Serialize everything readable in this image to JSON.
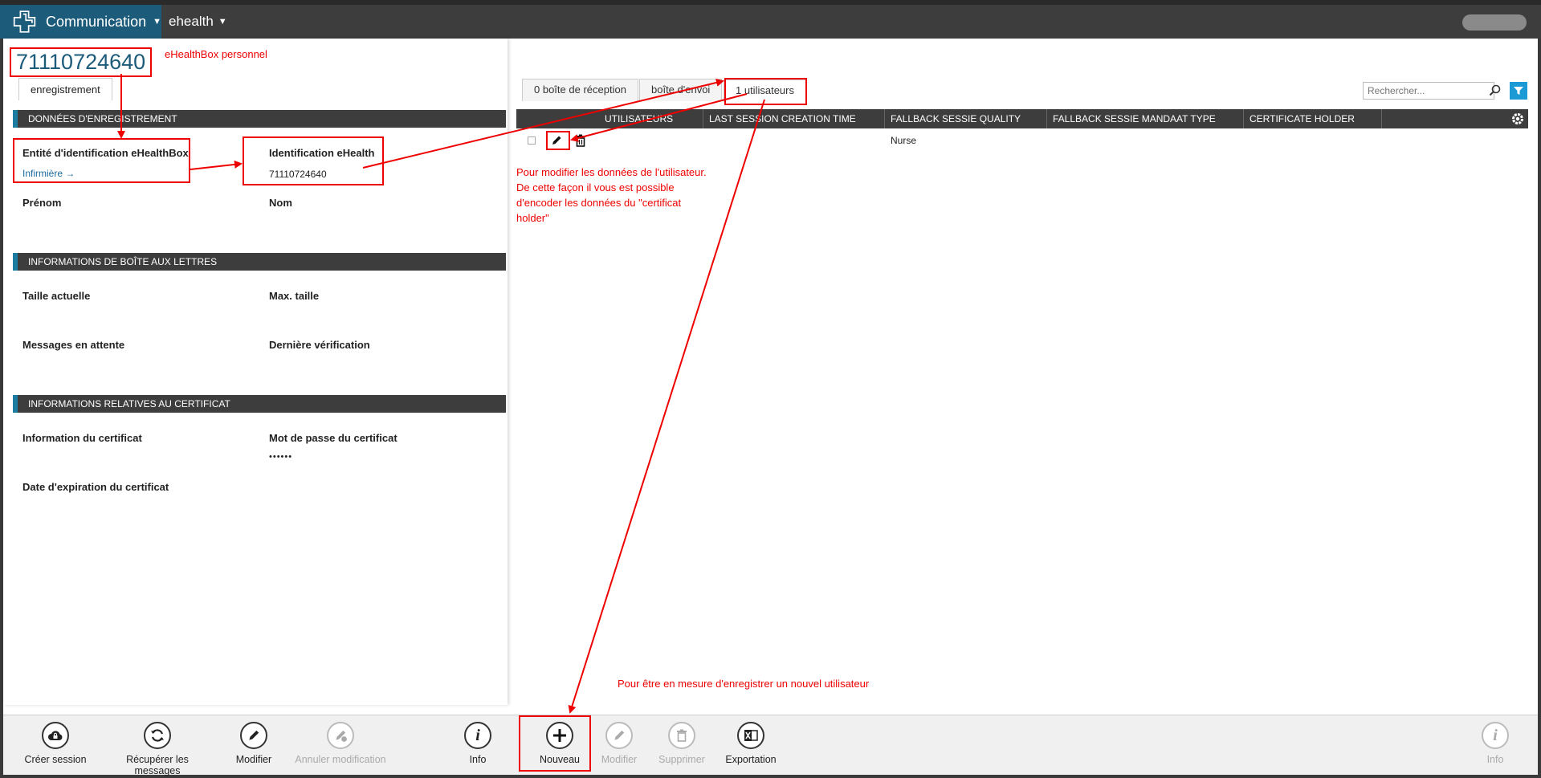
{
  "app": {
    "brand_label": "Communication",
    "menu_label": "ehealth"
  },
  "record": {
    "id": "71110724640",
    "annotation": "eHealthBox personnel"
  },
  "left": {
    "tab": "enregistrement",
    "sections": {
      "registration": "DONNÉES D'ENREGISTREMENT",
      "mailbox": "INFORMATIONS DE BOÎTE AUX LETTRES",
      "certificate": "INFORMATIONS RELATIVES AU CERTIFICAT"
    },
    "fields": {
      "entity_label": "Entité d'identification eHealthBox",
      "entity_value": "Infirmière",
      "entity_arrow": "→",
      "ident_label": "Identification eHealth",
      "ident_value": "71110724640",
      "firstname_label": "Prénom",
      "lastname_label": "Nom",
      "size_label": "Taille actuelle",
      "maxsize_label": "Max. taille",
      "pending_label": "Messages en attente",
      "lastcheck_label": "Dernière vérification",
      "certinfo_label": "Information du certificat",
      "certpass_label": "Mot de passe du certificat",
      "certpass_value": "••••••",
      "certexp_label": "Date d'expiration du certificat"
    }
  },
  "right": {
    "tabs": [
      "0 boîte de réception",
      "boîte d'envoi",
      "1 utilisateurs"
    ],
    "search_placeholder": "Rechercher...",
    "columns": [
      "UTILISATEURS",
      "LAST SESSION CREATION TIME",
      "FALLBACK SESSIE QUALITY",
      "FALLBACK SESSIE MANDAAT TYPE",
      "CERTIFICATE HOLDER"
    ],
    "rows": [
      {
        "quality": "Nurse"
      }
    ],
    "annotation_edit": [
      "Pour modifier les données de l'utilisateur.",
      "De cette façon il vous est possible",
      "d'encoder les données du \"certificat",
      "holder\""
    ],
    "annotation_new": "Pour être en mesure d'enregistrer un nouvel utilisateur"
  },
  "toolbar": {
    "create_session": "Créer session",
    "fetch_messages": "Récupérer les messages",
    "edit": "Modifier",
    "cancel_edit": "Annuler modification",
    "info": "Info",
    "new": "Nouveau",
    "modify": "Modifier",
    "delete": "Supprimer",
    "export": "Exportation",
    "info_right": "Info"
  },
  "colors": {
    "brand": "#1c5b7a",
    "annotation": "#e00000",
    "filter": "#1c9ad6"
  }
}
